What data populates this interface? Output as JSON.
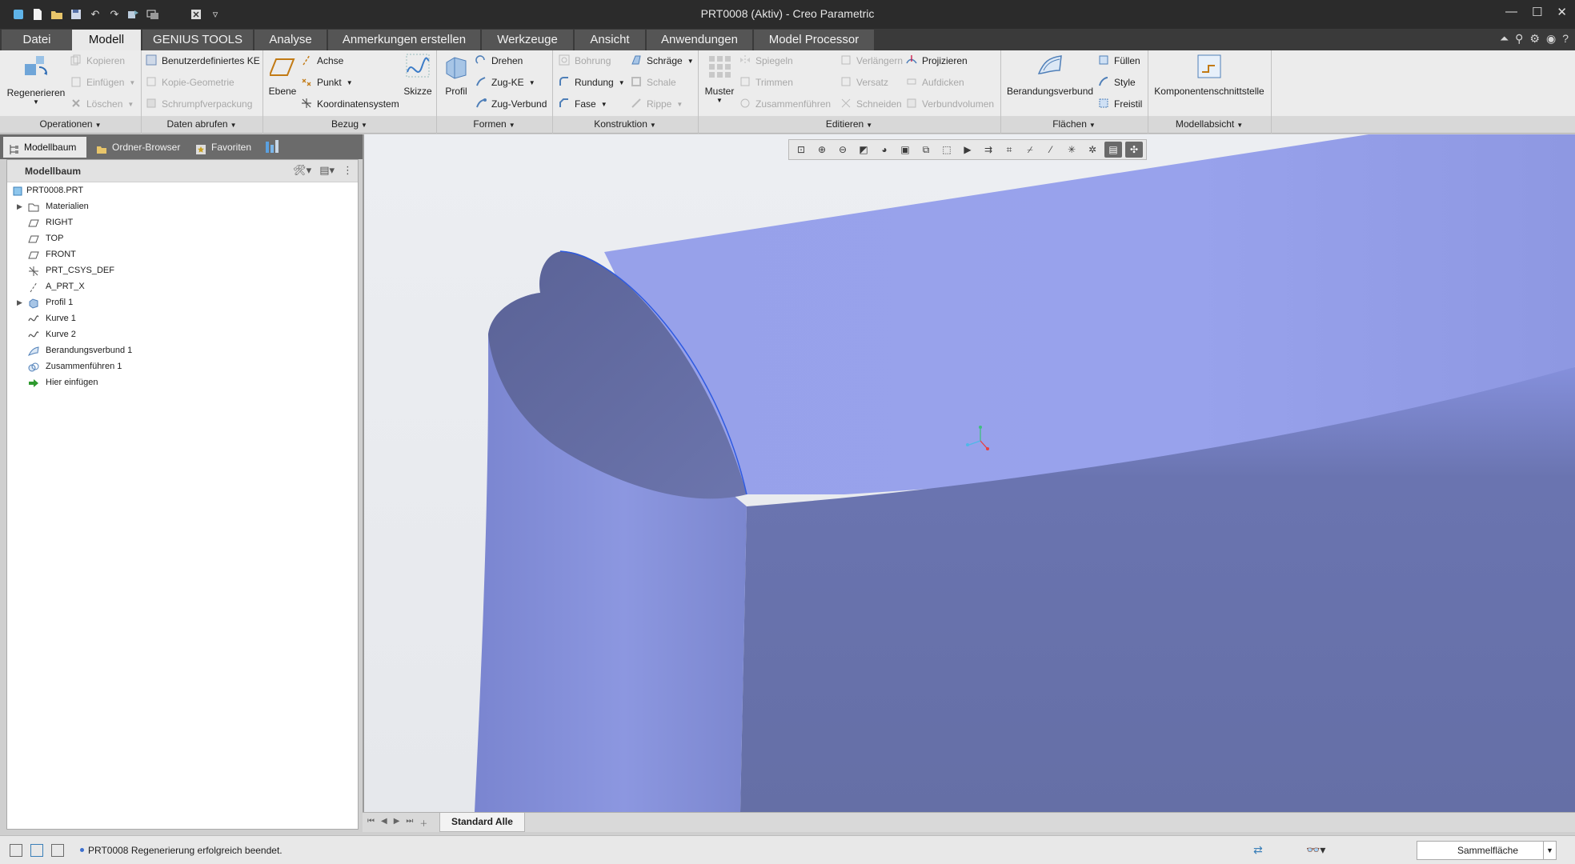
{
  "window": {
    "title": "PRT0008 (Aktiv) - Creo Parametric"
  },
  "quick_access": {
    "icons": [
      "app-icon",
      "new-icon",
      "open-icon",
      "save-icon",
      "undo-icon",
      "redo-icon",
      "regenerate-icon",
      "switch-window-icon",
      "close-window-icon",
      "customize-icon"
    ]
  },
  "tabs": [
    {
      "label": "Datei"
    },
    {
      "label": "Modell"
    },
    {
      "label": "GENIUS TOOLS"
    },
    {
      "label": "Analyse"
    },
    {
      "label": "Anmerkungen erstellen"
    },
    {
      "label": "Werkzeuge"
    },
    {
      "label": "Ansicht"
    },
    {
      "label": "Anwendungen"
    },
    {
      "label": "Model Processor"
    }
  ],
  "ribbon": {
    "operationen": {
      "group": "Operationen",
      "regenerieren": "Regenerieren",
      "kopieren": "Kopieren",
      "einfuegen": "Einfügen",
      "loeschen": "Löschen"
    },
    "daten": {
      "group": "Daten abrufen",
      "benutzer_ke": "Benutzerdefiniertes KE",
      "kopie_geometrie": "Kopie-Geometrie",
      "schrumpf": "Schrumpfverpackung"
    },
    "bezug": {
      "group": "Bezug",
      "ebene": "Ebene",
      "achse": "Achse",
      "punkt": "Punkt",
      "koord": "Koordinatensystem",
      "skizze": "Skizze"
    },
    "formen": {
      "group": "Formen",
      "profil": "Profil",
      "drehen": "Drehen",
      "zug_ke": "Zug-KE",
      "zug_verbund": "Zug-Verbund"
    },
    "konstruktion": {
      "group": "Konstruktion",
      "bohrung": "Bohrung",
      "rundung": "Rundung",
      "fase": "Fase",
      "schraege": "Schräge",
      "schale": "Schale",
      "rippe": "Rippe"
    },
    "editieren": {
      "group": "Editieren",
      "muster": "Muster",
      "spiegeln": "Spiegeln",
      "trimmen": "Trimmen",
      "zusammenfuehren": "Zusammenführen",
      "verlaengern": "Verlängern",
      "versatz": "Versatz",
      "schneiden": "Schneiden",
      "projizieren": "Projizieren",
      "aufdicken": "Aufdicken",
      "verbundvolumen": "Verbundvolumen"
    },
    "flaechen": {
      "group": "Flächen",
      "berandungsverbund": "Berandungsverbund",
      "fuellen": "Füllen",
      "style": "Style",
      "freistil": "Freistil"
    },
    "modellabsicht": {
      "group": "Modellabsicht",
      "komponentenschnittstelle": "Komponentenschnittstelle"
    }
  },
  "left_tabs": [
    {
      "label": "Modellbaum"
    },
    {
      "label": "Ordner-Browser"
    },
    {
      "label": "Favoriten"
    }
  ],
  "tree": {
    "header": "Modellbaum",
    "items": [
      {
        "label": "PRT0008.PRT",
        "icon": "part-icon"
      },
      {
        "label": "Materialien",
        "icon": "materials-icon"
      },
      {
        "label": "RIGHT",
        "icon": "datum-plane-icon"
      },
      {
        "label": "TOP",
        "icon": "datum-plane-icon"
      },
      {
        "label": "FRONT",
        "icon": "datum-plane-icon"
      },
      {
        "label": "PRT_CSYS_DEF",
        "icon": "csys-icon"
      },
      {
        "label": "A_PRT_X",
        "icon": "axis-icon"
      },
      {
        "label": "Profil 1",
        "icon": "extrude-icon"
      },
      {
        "label": "Kurve 1",
        "icon": "curve-icon"
      },
      {
        "label": "Kurve 2",
        "icon": "curve-icon"
      },
      {
        "label": "Berandungsverbund 1",
        "icon": "boundary-blend-icon"
      },
      {
        "label": "Zusammenführen 1",
        "icon": "merge-icon"
      },
      {
        "label": "Hier einfügen",
        "icon": "insert-here-icon"
      }
    ]
  },
  "viewport": {
    "surface_color": "#8f9be6",
    "edge_color": "#2f5be0"
  },
  "bottom_tab": "Standard Alle",
  "status": {
    "message": "PRT0008 Regenerierung erfolgreich beendet.",
    "filter": "Sammelfläche"
  }
}
